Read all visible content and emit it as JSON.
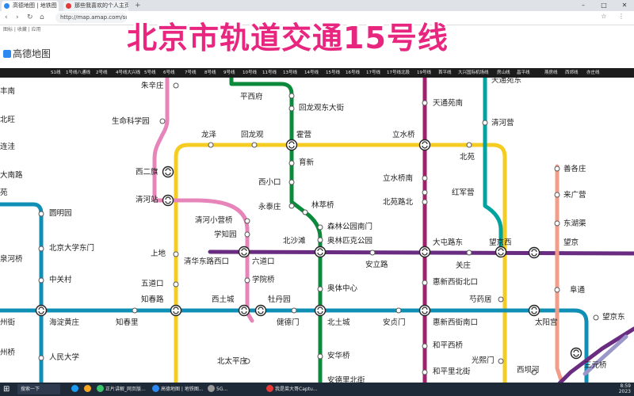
{
  "browser": {
    "tabs": [
      {
        "label": "高德地图 | 地铁图",
        "color": "#2b89f0"
      },
      {
        "label": "那些我喜欢的个人主页 · 豆瓣",
        "color": "#e53935"
      },
      {
        "label": "高德地图 | 地铁图",
        "color": "#2b89f0"
      }
    ],
    "new_tab": "+",
    "win_minimize": "–",
    "win_maximize": "□",
    "win_close": "✕",
    "back": "‹",
    "forward": "›",
    "reload": "↻",
    "home": "⌂",
    "url": "http://map.amap.com/subway/...",
    "bookmark_text": "图标 | 收藏 | 应用"
  },
  "site": {
    "logo": "高德地图",
    "banner_title": "北京市轨道交通15号线"
  },
  "line_bar": [
    "S1线",
    "1号线八通线",
    "2号线",
    "4号线大兴线",
    "5号线",
    "6号线",
    "7号线",
    "8号线",
    "9号线",
    "10号线",
    "11号线",
    "13号线",
    "14号线",
    "15号线",
    "16号线",
    "17号线",
    "17号线北段",
    "19号线",
    "首平线",
    "大兴国际机场线",
    "房山线",
    "昌平线",
    "燕房线",
    "西郊线",
    "亦庄线"
  ],
  "map": {
    "line_colors": {
      "line13": "#f5cc21",
      "line15": "#6a2c81",
      "line8": "#0b8a3b",
      "line5": "#a0216b",
      "line10": "#0f8fb5",
      "lineS2": "#e784b9",
      "line17": "#00a3a0",
      "lineSalmon": "#f19d8a",
      "line19": "#6a2c81",
      "changping": "#e07aa0"
    },
    "stations": [
      {
        "name": "天通苑东"
      },
      {
        "name": "丰南"
      },
      {
        "name": "朱辛庄"
      },
      {
        "name": "平西府"
      },
      {
        "name": "回龙观东大街"
      },
      {
        "name": "天通苑南"
      },
      {
        "name": "北旺"
      },
      {
        "name": "生命科学园"
      },
      {
        "name": "清河营"
      },
      {
        "name": "龙泽"
      },
      {
        "name": "回龙观"
      },
      {
        "name": "霍营"
      },
      {
        "name": "立水桥"
      },
      {
        "name": "连洼"
      },
      {
        "name": "北苑"
      },
      {
        "name": "育新"
      },
      {
        "name": "善各庄"
      },
      {
        "name": "西二旗"
      },
      {
        "name": "大南路"
      },
      {
        "name": "西小口"
      },
      {
        "name": "立水桥南"
      },
      {
        "name": "来广营"
      },
      {
        "name": "红军营"
      },
      {
        "name": "苑"
      },
      {
        "name": "清河站"
      },
      {
        "name": "永泰庄"
      },
      {
        "name": "林萃桥"
      },
      {
        "name": "北苑路北"
      },
      {
        "name": "圆明园"
      },
      {
        "name": "清河小营桥"
      },
      {
        "name": "森林公园南门"
      },
      {
        "name": "东湖渠"
      },
      {
        "name": "学知园"
      },
      {
        "name": "北沙滩"
      },
      {
        "name": "奥林匹克公园"
      },
      {
        "name": "大屯路东"
      },
      {
        "name": "望京西"
      },
      {
        "name": "望京"
      },
      {
        "name": "北京大学东门"
      },
      {
        "name": "上地"
      },
      {
        "name": "泉河桥"
      },
      {
        "name": "清华东路西口"
      },
      {
        "name": "六道口"
      },
      {
        "name": "安立路"
      },
      {
        "name": "关庄"
      },
      {
        "name": "中关村"
      },
      {
        "name": "学院桥"
      },
      {
        "name": "惠新西街北口"
      },
      {
        "name": "五道口"
      },
      {
        "name": "奥体中心"
      },
      {
        "name": "阜通"
      },
      {
        "name": "知春路"
      },
      {
        "name": "西土城"
      },
      {
        "name": "牡丹园"
      },
      {
        "name": "芍药居"
      },
      {
        "name": "州街"
      },
      {
        "name": "海淀黄庄"
      },
      {
        "name": "知春里"
      },
      {
        "name": "健德门"
      },
      {
        "name": "北土城"
      },
      {
        "name": "安贞门"
      },
      {
        "name": "惠新西街南口"
      },
      {
        "name": "太阳宫"
      },
      {
        "name": "望京东"
      },
      {
        "name": "和平西桥"
      },
      {
        "name": "州桥"
      },
      {
        "name": "安华桥"
      },
      {
        "name": "人民大学"
      },
      {
        "name": "光熙门"
      },
      {
        "name": "北太平庄"
      },
      {
        "name": "和平里北街"
      },
      {
        "name": "西坝河"
      },
      {
        "name": "三元桥"
      },
      {
        "name": "安德里北街"
      }
    ]
  },
  "taskbar": {
    "start": "⊞",
    "search": "搜索一下",
    "items": [
      {
        "label": "正片讲解_网页版..."
      },
      {
        "label": "高德地图 | 地铁图..."
      },
      {
        "label": "5G..."
      },
      {
        "label": "我是菜大哥Captu..."
      }
    ],
    "time": "8:59",
    "date": "2023"
  }
}
